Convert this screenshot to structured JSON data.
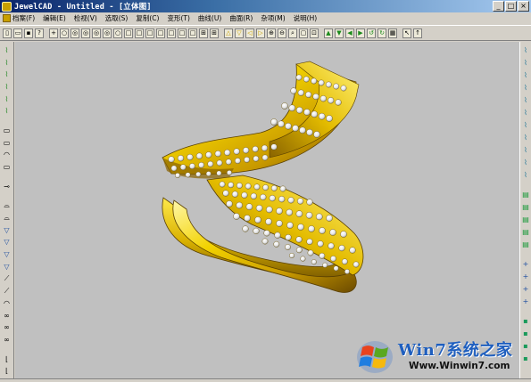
{
  "window": {
    "title": "JewelCAD - Untitled - [立体图]",
    "buttons": {
      "minimize": "_",
      "maximize": "□",
      "close": "×"
    }
  },
  "menu": {
    "items": [
      "档案(F)",
      "编辑(E)",
      "检视(V)",
      "选取(S)",
      "复制(C)",
      "变形(T)",
      "曲线(U)",
      "曲面(R)",
      "杂项(M)",
      "说明(H)"
    ]
  },
  "toolbar": {
    "icons": [
      "new-icon",
      "open-icon",
      "save-icon",
      "help-pointer-icon",
      "sep",
      "move-icon",
      "circle-icon",
      "target-icon",
      "target-icon",
      "target-icon",
      "target-icon",
      "circle-icon",
      "square-icon",
      "square-icon",
      "square-icon",
      "square-icon",
      "square-icon",
      "square-icon",
      "square-icon",
      "grid-icon",
      "grid-icon",
      "sep",
      "triangle-up-icon",
      "triangle-down-icon",
      "arrow-left-icon",
      "arrow-right-icon",
      "zoom-in-icon",
      "zoom-out-icon",
      "zoom-icon",
      "box-icon",
      "select-icon",
      "sep",
      "rotate-up-icon",
      "rotate-down-icon",
      "rotate-left-icon",
      "rotate-right-icon",
      "rotate-ccw-icon",
      "rotate-cw-icon",
      "render-icon",
      "sep",
      "pointer-icon",
      "arrow-up-icon"
    ],
    "glyphs": {
      "new-icon": "▯",
      "open-icon": "▭",
      "save-icon": "▪",
      "help-pointer-icon": "?",
      "move-icon": "+",
      "circle-icon": "○",
      "target-icon": "◎",
      "square-icon": "□",
      "grid-icon": "⊞",
      "triangle-up-icon": "△",
      "triangle-down-icon": "▽",
      "arrow-left-icon": "◁",
      "arrow-right-icon": "▷",
      "zoom-in-icon": "⊕",
      "zoom-out-icon": "⊖",
      "zoom-icon": "⌕",
      "box-icon": "▢",
      "select-icon": "⊡",
      "rotate-up-icon": "▲",
      "rotate-down-icon": "▼",
      "rotate-left-icon": "◀",
      "rotate-right-icon": "▶",
      "rotate-ccw-icon": "↺",
      "rotate-cw-icon": "↻",
      "render-icon": "▦",
      "pointer-icon": "↖",
      "arrow-up-icon": "↑"
    },
    "colors": {
      "triangle-up-icon": "#c8a000",
      "triangle-down-icon": "#c8a000",
      "arrow-left-icon": "#c8a000",
      "arrow-right-icon": "#c8a000",
      "rotate-up-icon": "#1a8a1a",
      "rotate-down-icon": "#1a8a1a",
      "rotate-left-icon": "#1a8a1a",
      "rotate-right-icon": "#1a8a1a",
      "rotate-ccw-icon": "#1a8a1a",
      "rotate-cw-icon": "#1a8a1a"
    }
  },
  "left_toolbar": {
    "icons": [
      "curve-tool-icon",
      "curve-tool-icon",
      "curve-tool-icon",
      "curve-tool-icon",
      "curve-tool-icon",
      "curve-tool-icon",
      "gap",
      "rect-tool-icon",
      "rect-tool-icon",
      "arc-tool-icon",
      "rect-tool-icon",
      "gap",
      "cut-tool-icon",
      "gap",
      "shape-tool-icon",
      "shape-tool-icon",
      "triangle-tool-icon",
      "triangle-tool-icon",
      "triangle-tool-icon",
      "triangle-tool-icon",
      "slant-tool-icon",
      "slant-tool-icon",
      "arc-tool-icon",
      "loop-tool-icon",
      "loop-tool-icon",
      "loop-tool-icon",
      "gap",
      "bracket-tool-icon",
      "bracket-tool-icon"
    ],
    "glyphs": {
      "curve-tool-icon": "⌇",
      "rect-tool-icon": "▭",
      "arc-tool-icon": "◠",
      "cut-tool-icon": "⊸",
      "shape-tool-icon": "⌓",
      "triangle-tool-icon": "▽",
      "slant-tool-icon": "⟋",
      "loop-tool-icon": "∞",
      "bracket-tool-icon": "⌊"
    },
    "colors": {
      "curve-tool-icon": "#2a8a2a",
      "triangle-tool-icon": "#1f4fa0"
    }
  },
  "right_toolbar": {
    "icons": [
      "edit-tool-icon",
      "edit-tool-icon",
      "edit-tool-icon",
      "edit-tool-icon",
      "edit-tool-icon",
      "edit-tool-icon",
      "edit-tool-icon",
      "edit-tool-icon",
      "edit-tool-icon",
      "edit-tool-icon",
      "edit-tool-icon",
      "gap",
      "surface-tool-icon",
      "surface-tool-icon",
      "surface-tool-icon",
      "surface-tool-icon",
      "surface-tool-icon",
      "gap",
      "plus-tool-icon",
      "plus-tool-icon",
      "plus-tool-icon",
      "plus-tool-icon",
      "gap",
      "snap-tool-icon",
      "snap-tool-icon",
      "snap-tool-icon",
      "snap-tool-icon"
    ],
    "glyphs": {
      "edit-tool-icon": "⌇",
      "surface-tool-icon": "▤",
      "plus-tool-icon": "+",
      "snap-tool-icon": "▪"
    },
    "colors": {
      "edit-tool-icon": "#2a7a9a",
      "surface-tool-icon": "#1a9a3a",
      "plus-tool-icon": "#1f4fa0",
      "snap-tool-icon": "#1a9a5a"
    }
  },
  "viewport": {
    "background": "#c0c0c0",
    "gold_light": "#fff27a",
    "gold_mid": "#e8c400",
    "gold_dark": "#7a5a00",
    "diamond": "#f4f4f4"
  },
  "watermark": {
    "title": "Win7系统之家",
    "url": "Www.Winwin7.com"
  }
}
